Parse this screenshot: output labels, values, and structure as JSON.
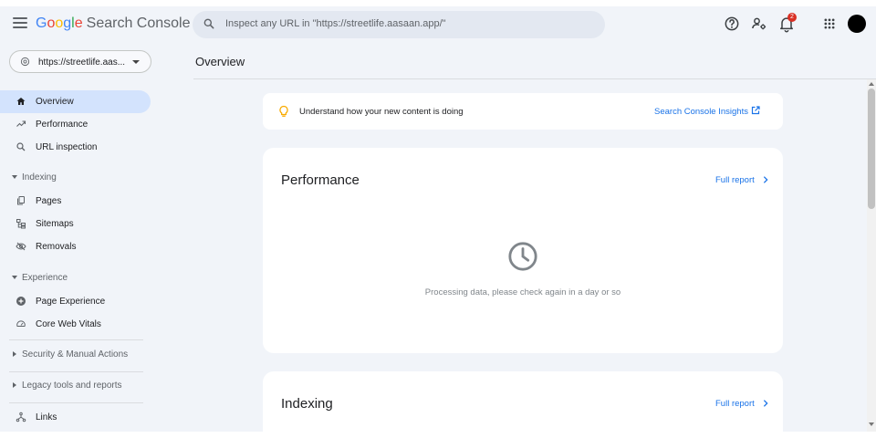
{
  "header": {
    "logo_letters": [
      "G",
      "o",
      "o",
      "g",
      "l",
      "e"
    ],
    "product": "Search Console",
    "search_placeholder": "Inspect any URL in \"https://streetlife.aasaan.app/\"",
    "notification_count": "2",
    "icons": [
      "menu-icon",
      "search-icon",
      "help-icon",
      "manage-users-icon",
      "notifications-icon",
      "apps-grid-icon",
      "avatar"
    ]
  },
  "sidebar": {
    "property": "https://streetlife.aas...",
    "items": [
      {
        "label": "Overview",
        "icon": "home-icon",
        "active": true
      },
      {
        "label": "Performance",
        "icon": "trending-icon"
      },
      {
        "label": "URL inspection",
        "icon": "search-icon"
      }
    ],
    "sections": {
      "indexing": {
        "label": "Indexing",
        "items": [
          {
            "label": "Pages",
            "icon": "pages-icon"
          },
          {
            "label": "Sitemaps",
            "icon": "sitemap-icon"
          },
          {
            "label": "Removals",
            "icon": "eye-off-icon"
          }
        ]
      },
      "experience": {
        "label": "Experience",
        "items": [
          {
            "label": "Page Experience",
            "icon": "plus-circle-icon"
          },
          {
            "label": "Core Web Vitals",
            "icon": "speedometer-icon"
          }
        ]
      },
      "security": {
        "label": "Security & Manual Actions"
      },
      "legacy": {
        "label": "Legacy tools and reports"
      },
      "links": {
        "label": "Links",
        "icon": "links-icon"
      }
    }
  },
  "main": {
    "title": "Overview",
    "insight": {
      "text": "Understand how your new content is doing",
      "link": "Search Console Insights"
    },
    "cards": [
      {
        "title": "Performance",
        "link": "Full report",
        "message": "Processing data, please check again in a day or so"
      },
      {
        "title": "Indexing",
        "link": "Full report"
      }
    ]
  },
  "colors": {
    "accent": "#1a73e8",
    "active_bg": "#d3e3fd",
    "page_bg": "#f1f4f9",
    "badge": "#d93025"
  }
}
